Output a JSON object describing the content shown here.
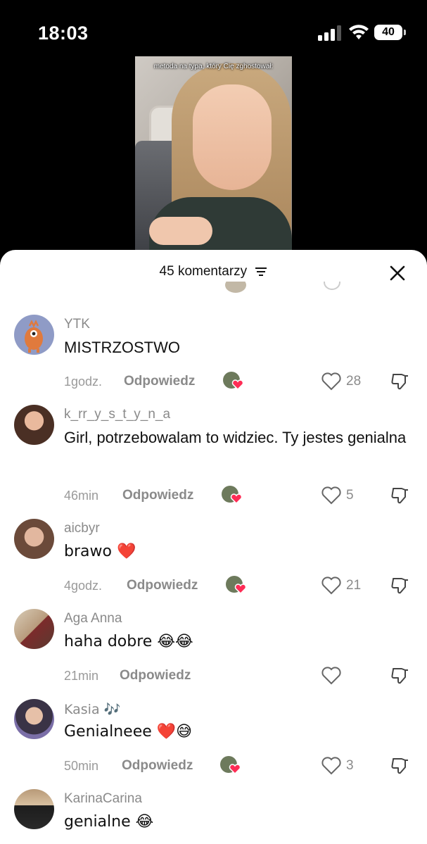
{
  "status": {
    "time": "18:03",
    "battery": "40"
  },
  "video": {
    "caption": "metoda na typa, który Cię zghostował:"
  },
  "sheet": {
    "title": "45 komentarzy"
  },
  "comments": [
    {
      "user": "YTK",
      "text": "MISTRZOSTWO",
      "time": "1godz.",
      "reply": "Odpowiedz",
      "likes": "28",
      "creator_liked": true
    },
    {
      "user": "k_rr_y_s_t_y_n_a",
      "text": "Girl, potrzebowalam to widziec. Ty jestes genialna",
      "time": "46min",
      "reply": "Odpowiedz",
      "likes": "5",
      "creator_liked": true
    },
    {
      "user": "aicbyr",
      "text": "brawo ❤️",
      "time": "4godz.",
      "reply": "Odpowiedz",
      "likes": "21",
      "creator_liked": true
    },
    {
      "user": "Aga Anna",
      "text": "haha dobre 😂😂",
      "time": "21min",
      "reply": "Odpowiedz",
      "likes": "",
      "creator_liked": false
    },
    {
      "user": "Kasia 🎶",
      "text": "Genialneee ❤️😅",
      "time": "50min",
      "reply": "Odpowiedz",
      "likes": "3",
      "creator_liked": true
    },
    {
      "user": "KarinaCarina",
      "text": "genialne 😂",
      "time": "",
      "reply": "",
      "likes": "",
      "creator_liked": false
    }
  ],
  "icons": {
    "sort": "sort-icon",
    "close": "close-icon",
    "heart": "heart-icon",
    "dislike": "dislike-icon",
    "signal": "signal-icon",
    "wifi": "wifi-icon",
    "battery": "battery-icon"
  },
  "colors": {
    "meta_gray": "#8a8a8a",
    "heart_red": "#fe2c55"
  }
}
